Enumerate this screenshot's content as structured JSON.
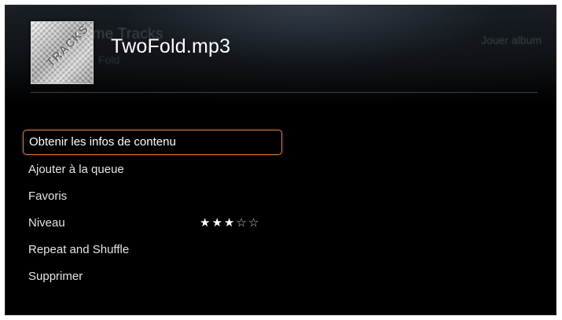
{
  "header": {
    "ghost_title": "Chrome Tracks",
    "ghost_subtitle": "Fold",
    "ghost_action": "Jouer album",
    "file_title": "TwoFold.mp3",
    "album_art_lettering": "TRACKS"
  },
  "menu": {
    "items": [
      {
        "label": "Obtenir les infos de contenu",
        "selected": true
      },
      {
        "label": "Ajouter à la queue"
      },
      {
        "label": "Favoris"
      },
      {
        "label": "Niveau"
      },
      {
        "label": "Repeat and Shuffle"
      },
      {
        "label": "Supprimer"
      }
    ]
  },
  "rating": {
    "value": 3,
    "max": 5,
    "filled_glyph": "★",
    "empty_glyph": "☆"
  },
  "colors": {
    "background": "#000000",
    "text": "#e4e4e4",
    "selection_border": "#d07a3c"
  }
}
